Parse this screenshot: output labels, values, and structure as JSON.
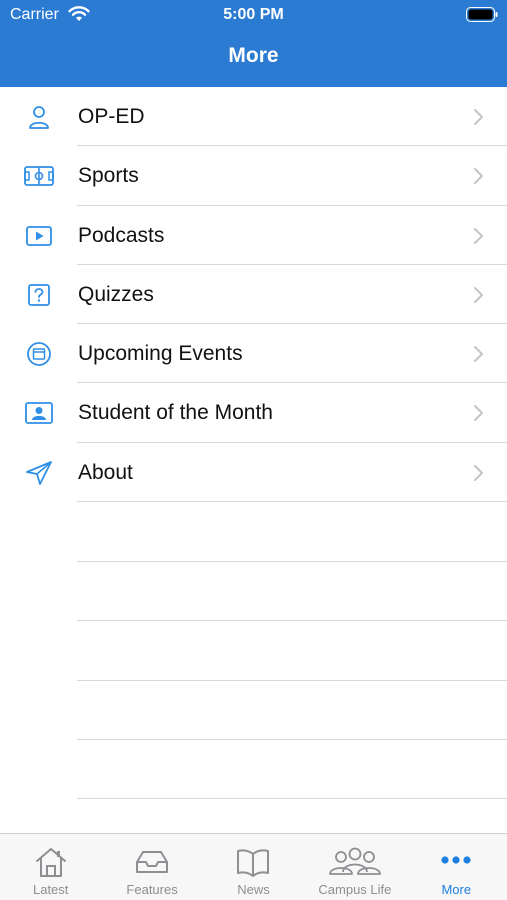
{
  "status_bar": {
    "carrier": "Carrier",
    "time": "5:00 PM"
  },
  "nav": {
    "title": "More"
  },
  "menu": {
    "items": [
      {
        "label": "OP-ED",
        "icon": "person-icon"
      },
      {
        "label": "Sports",
        "icon": "field-icon"
      },
      {
        "label": "Podcasts",
        "icon": "play-icon"
      },
      {
        "label": "Quizzes",
        "icon": "question-icon"
      },
      {
        "label": "Upcoming Events",
        "icon": "calendar-icon"
      },
      {
        "label": "Student of the Month",
        "icon": "id-card-icon"
      },
      {
        "label": "About",
        "icon": "send-icon"
      }
    ]
  },
  "tabbar": {
    "tabs": [
      {
        "label": "Latest",
        "icon": "house-icon",
        "active": false
      },
      {
        "label": "Features",
        "icon": "tray-icon",
        "active": false
      },
      {
        "label": "News",
        "icon": "book-icon",
        "active": false
      },
      {
        "label": "Campus Life",
        "icon": "group-icon",
        "active": false
      },
      {
        "label": "More",
        "icon": "ellipsis-icon",
        "active": true
      }
    ]
  },
  "colors": {
    "brand": "#2c7bd3",
    "accent": "#1f7fe0",
    "inactive": "#8e8e93",
    "icon": "#2f8fe6"
  }
}
